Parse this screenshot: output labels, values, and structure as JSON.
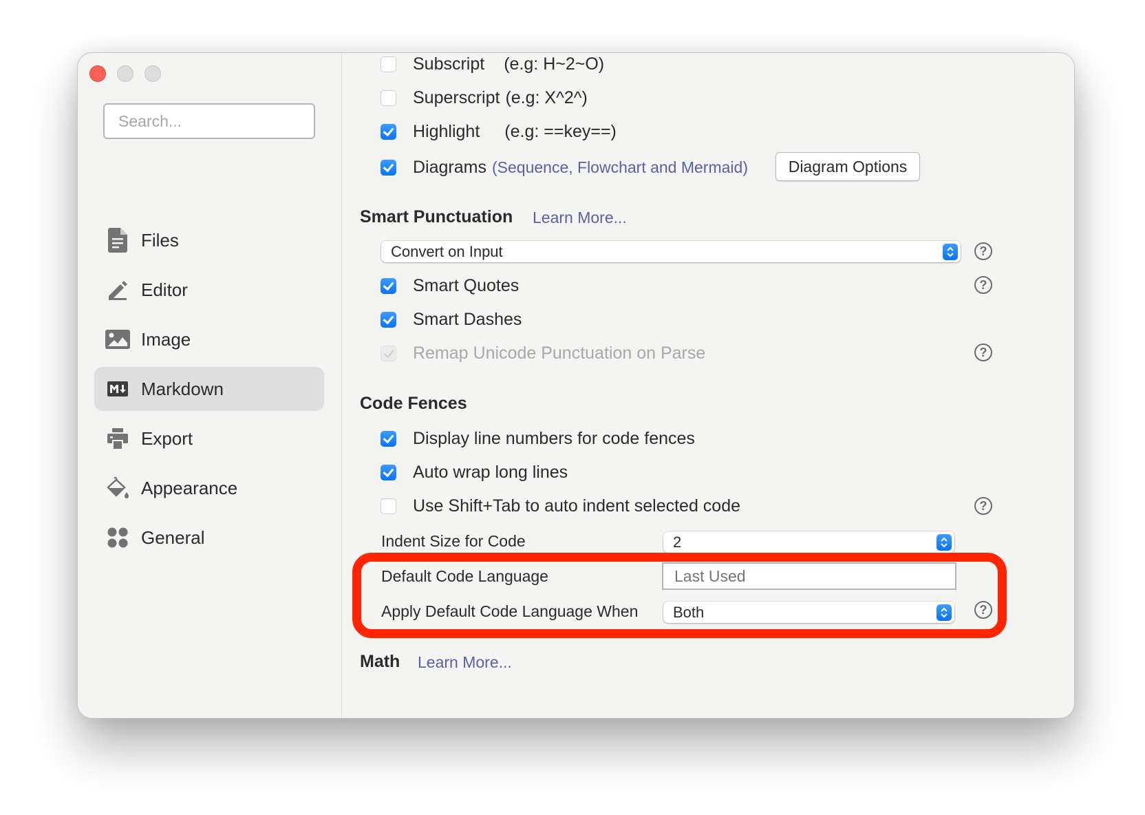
{
  "window": {
    "traffic_lights": [
      "close",
      "minimize",
      "zoom"
    ]
  },
  "sidebar": {
    "search_placeholder": "Search...",
    "items": [
      {
        "label": "Files",
        "icon": "file-icon",
        "active": false
      },
      {
        "label": "Editor",
        "icon": "pencil-icon",
        "active": false
      },
      {
        "label": "Image",
        "icon": "image-icon",
        "active": false
      },
      {
        "label": "Markdown",
        "icon": "markdown-icon",
        "active": true
      },
      {
        "label": "Export",
        "icon": "printer-icon",
        "active": false
      },
      {
        "label": "Appearance",
        "icon": "paint-bucket-icon",
        "active": false
      },
      {
        "label": "General",
        "icon": "grid-icon",
        "active": false
      }
    ]
  },
  "syntax": {
    "subscript": {
      "label": "Subscript",
      "hint": "(e.g: H~2~O)",
      "checked": false
    },
    "superscript": {
      "label": "Superscript",
      "hint": "(e.g: X^2^)",
      "checked": false
    },
    "highlight": {
      "label": "Highlight",
      "hint": "(e.g: ==key==)",
      "checked": true
    },
    "diagrams": {
      "label": "Diagrams",
      "hint": "(Sequence, Flowchart and Mermaid)",
      "checked": true,
      "button": "Diagram Options"
    }
  },
  "smart_punctuation": {
    "title": "Smart Punctuation",
    "learn_more": "Learn More...",
    "mode": "Convert on Input",
    "smart_quotes": {
      "label": "Smart Quotes",
      "checked": true
    },
    "smart_dashes": {
      "label": "Smart Dashes",
      "checked": true
    },
    "remap_unicode": {
      "label": "Remap Unicode Punctuation on Parse",
      "checked": true,
      "disabled": true
    }
  },
  "code_fences": {
    "title": "Code Fences",
    "line_numbers": {
      "label": "Display line numbers for code fences",
      "checked": true
    },
    "auto_wrap": {
      "label": "Auto wrap long lines",
      "checked": true
    },
    "shift_tab": {
      "label": "Use Shift+Tab to auto indent selected code",
      "checked": false
    },
    "indent_size": {
      "label": "Indent Size for Code",
      "value": "2"
    },
    "default_language": {
      "label": "Default Code Language",
      "placeholder": "Last Used",
      "value": ""
    },
    "apply_when": {
      "label": "Apply Default Code Language When",
      "value": "Both"
    }
  },
  "math": {
    "title": "Math",
    "learn_more": "Learn More..."
  },
  "help_symbol": "?",
  "colors": {
    "accent": "#0a74f5",
    "link": "#5d5fa4",
    "annotation": "#ff2500",
    "close_button": "#fe5f57"
  }
}
